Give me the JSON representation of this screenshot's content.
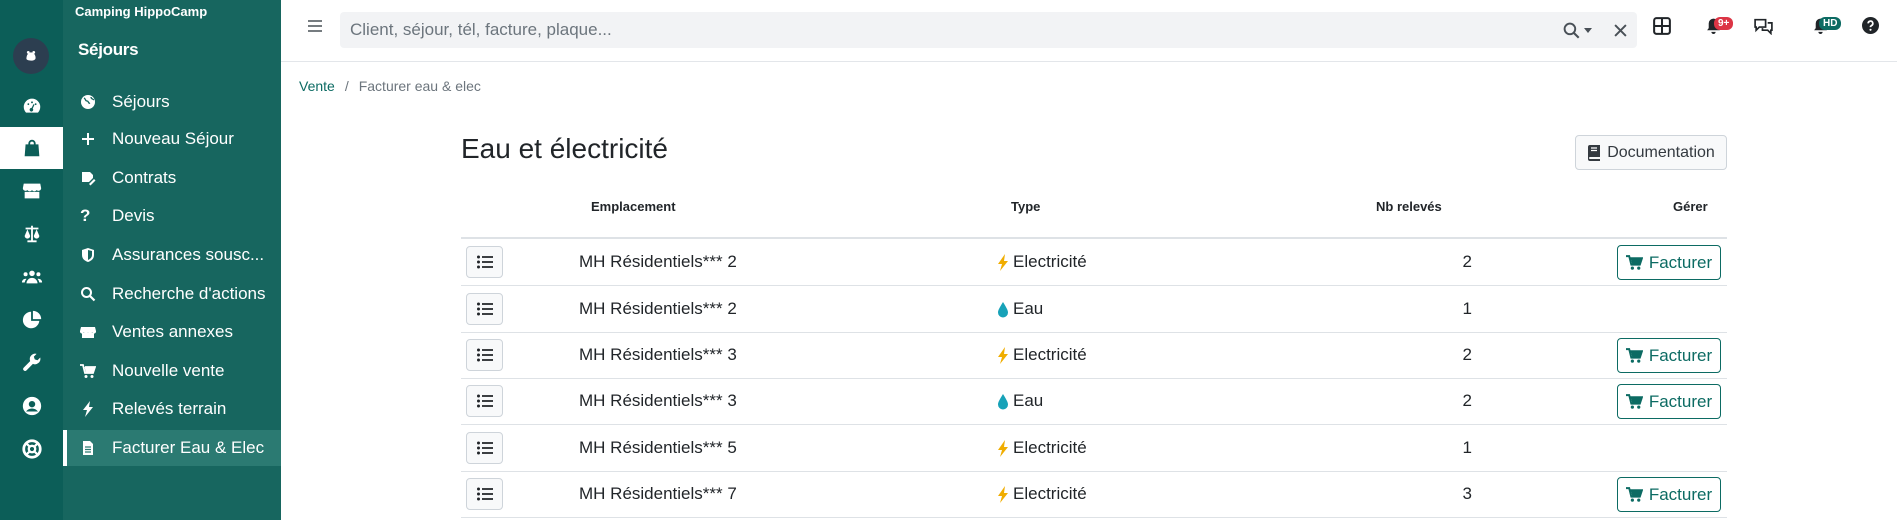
{
  "app": {
    "name": "Camping HippoCamp",
    "section": "Séjours"
  },
  "rail": {
    "icons": [
      "logo-icon",
      "dashboard-icon",
      "bag-icon",
      "store-icon",
      "scale-icon",
      "users-icon",
      "pie-chart-icon",
      "wrench-icon",
      "user-circle-icon",
      "lifebuoy-icon"
    ],
    "active": "bag-icon"
  },
  "sidebar": {
    "items": [
      {
        "label": "Séjours",
        "icon": "globe-icon"
      },
      {
        "label": "Nouveau Séjour",
        "icon": "plus-icon"
      },
      {
        "label": "Contrats",
        "icon": "signature-icon"
      },
      {
        "label": "Devis",
        "icon": "question-icon"
      },
      {
        "label": "Assurances sousc...",
        "icon": "shield-icon"
      },
      {
        "label": "Recherche d'actions",
        "icon": "search-icon"
      },
      {
        "label": "Ventes annexes",
        "icon": "store-icon"
      },
      {
        "label": "Nouvelle vente",
        "icon": "cart-icon"
      },
      {
        "label": "Relevés terrain",
        "icon": "bolt-icon"
      },
      {
        "label": "Facturer Eau & Elec",
        "icon": "invoice-icon",
        "active": true
      }
    ]
  },
  "topbar": {
    "search_placeholder": "Client, séjour, tél, facture, plaque...",
    "notifications_badge": "9+",
    "user_badge": "HD"
  },
  "breadcrumb": {
    "parent": "Vente",
    "current": "Facturer eau & elec"
  },
  "page": {
    "title": "Eau et électricité",
    "doc_button": "Documentation"
  },
  "table": {
    "headers": {
      "emplacement": "Emplacement",
      "type": "Type",
      "nb": "Nb relevés",
      "gerer": "Gérer"
    },
    "action_label": "Facturer",
    "rows": [
      {
        "emplacement": "MH Résidentiels*** 2",
        "type": "Electricité",
        "kind": "elec",
        "nb": "2",
        "factura": true
      },
      {
        "emplacement": "MH Résidentiels*** 2",
        "type": "Eau",
        "kind": "eau",
        "nb": "1",
        "factura": false
      },
      {
        "emplacement": "MH Résidentiels*** 3",
        "type": "Electricité",
        "kind": "elec",
        "nb": "2",
        "factura": true
      },
      {
        "emplacement": "MH Résidentiels*** 3",
        "type": "Eau",
        "kind": "eau",
        "nb": "2",
        "factura": true
      },
      {
        "emplacement": "MH Résidentiels*** 5",
        "type": "Electricité",
        "kind": "elec",
        "nb": "1",
        "factura": false
      },
      {
        "emplacement": "MH Résidentiels*** 7",
        "type": "Electricité",
        "kind": "elec",
        "nb": "3",
        "factura": true
      }
    ]
  },
  "colors": {
    "primary": "#0c6b63",
    "sidebar": "#17665f",
    "rail": "#0c5e58",
    "danger": "#dc3545",
    "bolt": "#f0ad00",
    "water": "#17a2b8"
  }
}
